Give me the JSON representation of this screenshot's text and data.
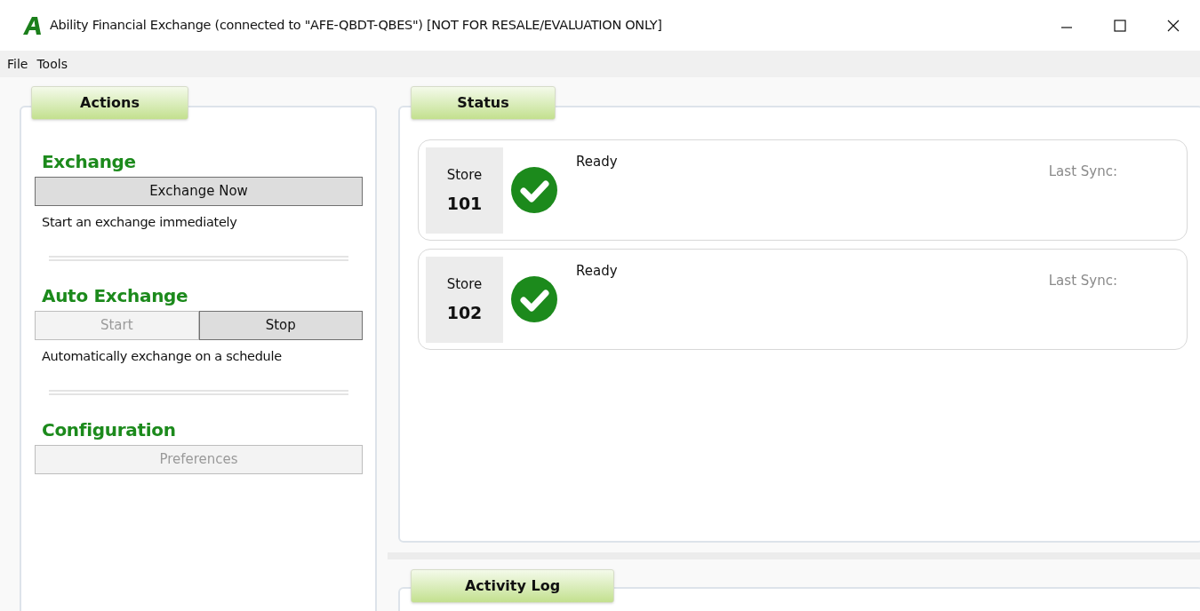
{
  "window": {
    "title": "Ability Financial Exchange (connected to \"AFE-QBDT-QBES\") [NOT FOR RESALE/EVALUATION ONLY]"
  },
  "menu": [
    {
      "label": "File"
    },
    {
      "label": "Tools"
    }
  ],
  "actions": {
    "title": "Actions",
    "sections": [
      {
        "heading": "Exchange",
        "buttons": [
          {
            "label": "Exchange Now",
            "disabled": false
          }
        ],
        "description": "Start an exchange immediately"
      },
      {
        "heading": "Auto Exchange",
        "buttons": [
          {
            "label": "Start",
            "disabled": true
          },
          {
            "label": "Stop",
            "disabled": false
          }
        ],
        "description": "Automatically exchange on a schedule"
      },
      {
        "heading": "Configuration",
        "buttons": [
          {
            "label": "Preferences",
            "disabled": true
          }
        ]
      }
    ]
  },
  "status": {
    "title": "Status",
    "stores": [
      {
        "label": "Store",
        "number": "101",
        "state": "Ready",
        "last_sync_label": "Last Sync:"
      },
      {
        "label": "Store",
        "number": "102",
        "state": "Ready",
        "last_sync_label": "Last Sync:"
      }
    ]
  },
  "activity_log": {
    "title": "Activity Log"
  }
}
